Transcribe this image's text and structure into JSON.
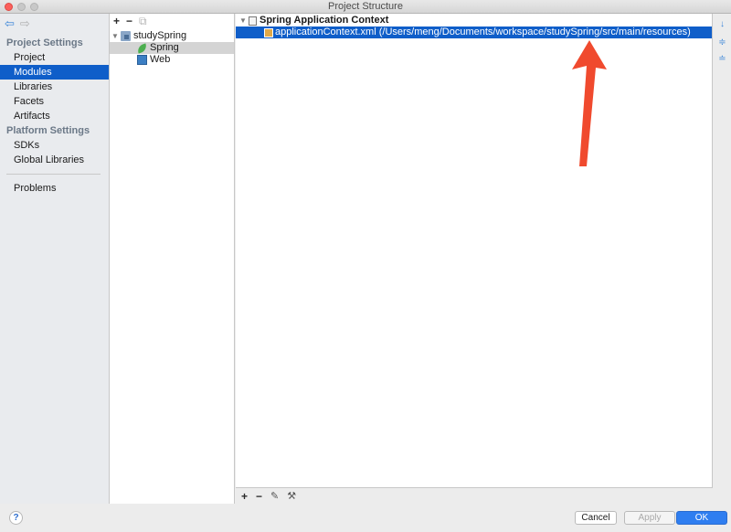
{
  "window": {
    "title": "Project Structure"
  },
  "sidebar": {
    "project_settings_header": "Project Settings",
    "project_settings_items": [
      {
        "label": "Project",
        "selected": false
      },
      {
        "label": "Modules",
        "selected": true
      },
      {
        "label": "Libraries",
        "selected": false
      },
      {
        "label": "Facets",
        "selected": false
      },
      {
        "label": "Artifacts",
        "selected": false
      }
    ],
    "platform_settings_header": "Platform Settings",
    "platform_settings_items": [
      {
        "label": "SDKs"
      },
      {
        "label": "Global Libraries"
      }
    ],
    "problems_label": "Problems"
  },
  "modules_toolbar": {
    "add": "+",
    "remove": "−",
    "copy_icon": "copy-icon"
  },
  "module_tree": {
    "root": {
      "label": "studySpring",
      "expanded": true
    },
    "children": [
      {
        "label": "Spring",
        "icon": "spring-leaf-icon",
        "selected": true
      },
      {
        "label": "Web",
        "icon": "web-icon",
        "selected": false
      }
    ]
  },
  "context": {
    "title": "Spring Application Context",
    "file": "applicationContext.xml (/Users/meng/Documents/workspace/studySpring/src/main/resources)"
  },
  "bottom_toolbar": {
    "add": "+",
    "remove": "−",
    "edit_icon": "pencil-icon",
    "settings_icon": "wrench-icon"
  },
  "right_rail_icons": [
    "sort-icon",
    "expand-all-icon",
    "collapse-all-icon"
  ],
  "footer": {
    "help": "?",
    "cancel": "Cancel",
    "apply": "Apply",
    "ok": "OK"
  },
  "colors": {
    "selection": "#0f5ec9",
    "annotation_arrow": "#f04a2e",
    "primary_button": "#2f7ef0"
  }
}
